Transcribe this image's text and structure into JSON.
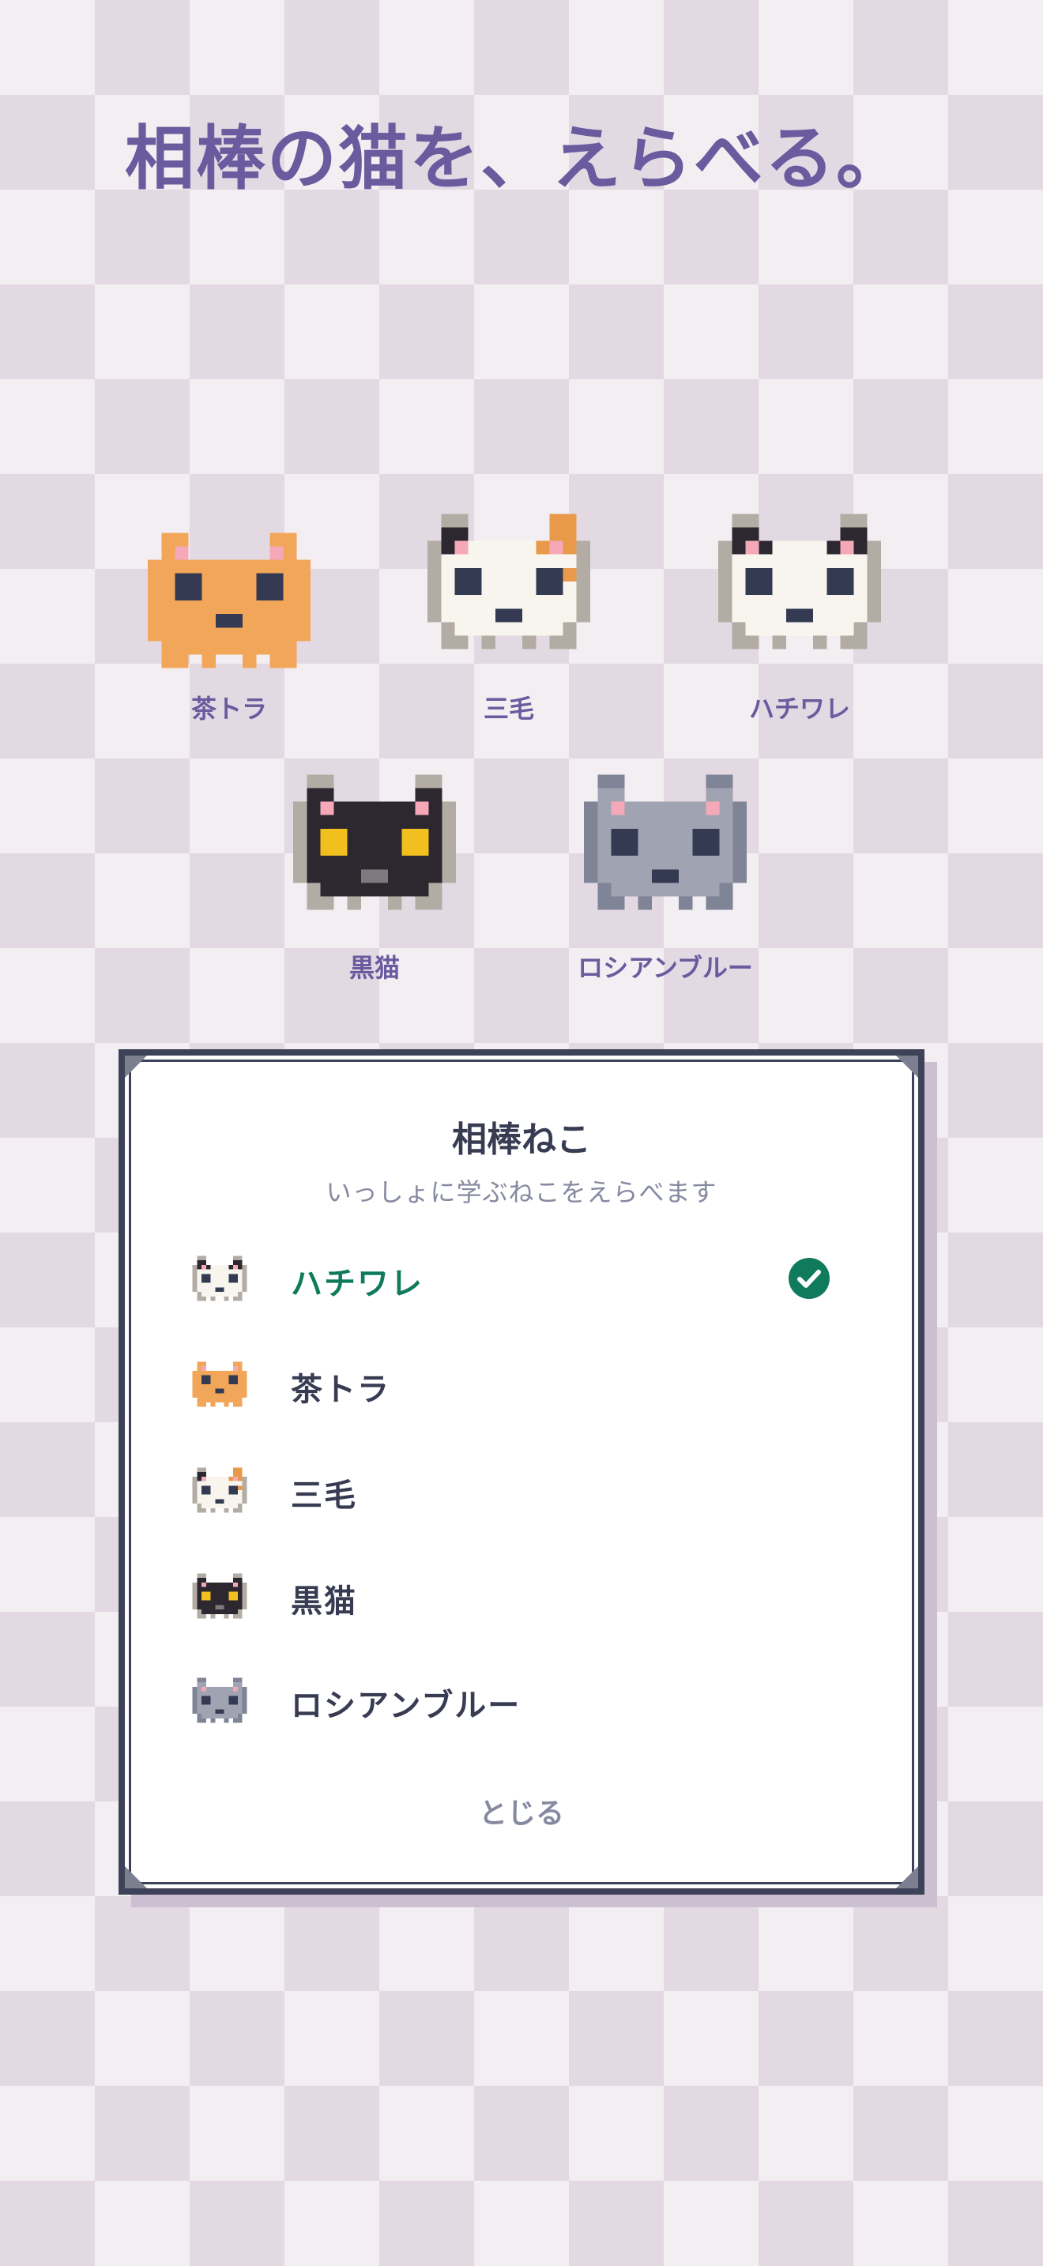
{
  "headline": "相棒の猫を、えらべる。",
  "cats": [
    {
      "id": "chatora",
      "label": "茶トラ"
    },
    {
      "id": "mike",
      "label": "三毛"
    },
    {
      "id": "hachiware",
      "label": "ハチワレ"
    },
    {
      "id": "kuroneko",
      "label": "黒猫"
    },
    {
      "id": "russian-blue",
      "label": "ロシアンブルー"
    }
  ],
  "dialog": {
    "title": "相棒ねこ",
    "subtitle": "いっしょに学ぶねこをえらべます",
    "selected": "ハチワレ",
    "items": [
      {
        "label": "ハチワレ",
        "icon": "hachiware-cat-icon",
        "selected": true
      },
      {
        "label": "茶トラ",
        "icon": "chatora-cat-icon",
        "selected": false
      },
      {
        "label": "三毛",
        "icon": "mike-cat-icon",
        "selected": false
      },
      {
        "label": "黒猫",
        "icon": "kuroneko-cat-icon",
        "selected": false
      },
      {
        "label": "ロシアンブルー",
        "icon": "russian-blue-cat-icon",
        "selected": false
      }
    ],
    "check_icon": "check-circle-icon",
    "close_label": "とじる"
  },
  "colors": {
    "headline": "#6a5a9e",
    "accent_green": "#0f7a5c",
    "dialog_border": "#3d4258",
    "checker_light": "#f2eef2",
    "checker_dark": "#e3d9e3"
  }
}
